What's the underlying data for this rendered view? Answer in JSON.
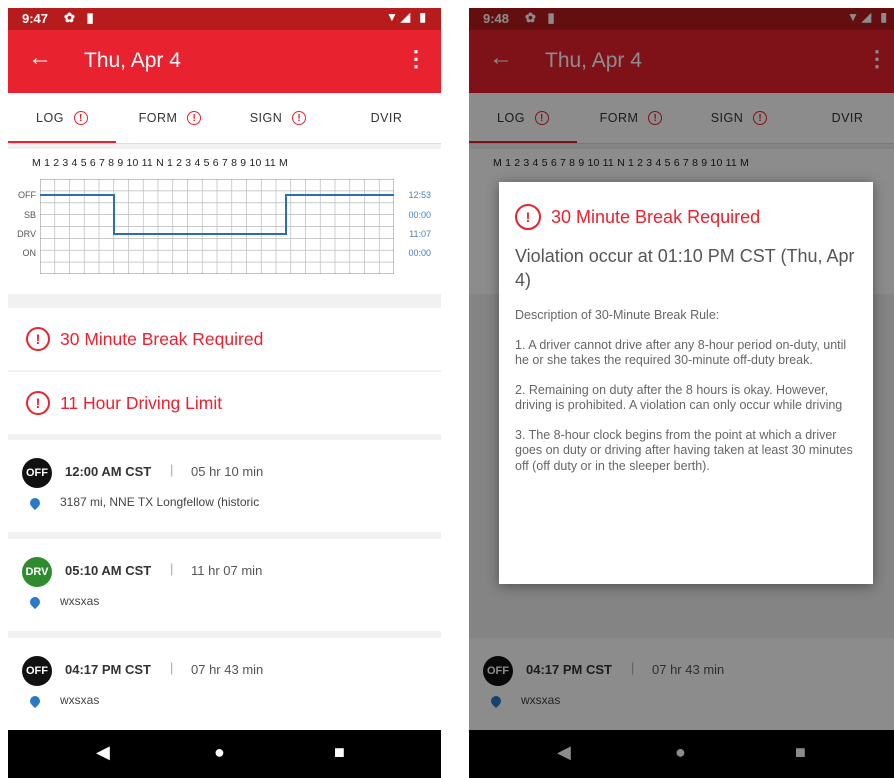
{
  "left": {
    "status": {
      "time": "9:47"
    },
    "appbar": {
      "title": "Thu, Apr 4"
    },
    "tabs": [
      {
        "label": "LOG"
      },
      {
        "label": "FORM"
      },
      {
        "label": "SIGN"
      },
      {
        "label": "DVIR"
      }
    ],
    "graph": {
      "hour_labels": "M 1 2 3 4 5 6 7 8 9 10 11 N 1 2 3 4 5 6 7 8 9 10 11 M",
      "rows": [
        {
          "status": "OFF",
          "total": "12:53"
        },
        {
          "status": "SB",
          "total": "00:00"
        },
        {
          "status": "DRV",
          "total": "11:07"
        },
        {
          "status": "ON",
          "total": "00:00"
        }
      ]
    },
    "violations": [
      {
        "label": "30 Minute Break Required"
      },
      {
        "label": "11 Hour Driving Limit"
      }
    ],
    "entries": [
      {
        "badge": "OFF",
        "time": "12:00 AM CST",
        "duration": "05 hr 10 min",
        "location": "3187 mi, NNE TX Longfellow (historic"
      },
      {
        "badge": "DRV",
        "time": "05:10 AM CST",
        "duration": "11 hr 07 min",
        "location": "wxsxas"
      },
      {
        "badge": "OFF",
        "time": "04:17 PM CST",
        "duration": "07 hr 43 min",
        "location": "wxsxas"
      }
    ],
    "separator": "|"
  },
  "right": {
    "status": {
      "time": "9:48"
    },
    "dialog": {
      "title": "30 Minute Break Required",
      "subtitle": "Violation occur at 01:10 PM CST (Thu, Apr 4)",
      "heading": "Description of 30-Minute Break Rule:",
      "p1": "1. A driver cannot drive after any 8-hour period on-duty, until he or she takes the required 30-minute off-duty break.",
      "p2": "2. Remaining on duty after the 8 hours is okay. However, driving is prohibited. A violation can only occur while driving",
      "p3": "3. The 8-hour clock begins from the point at which a driver goes on duty or driving after having taken at least 30 minutes off (off duty or in the sleeper berth)."
    }
  },
  "colors": {
    "accent": "#e8222e",
    "statusbar": "#b71c1c",
    "off_badge": "#111111",
    "drv_badge": "#2e8b2e",
    "line": "#2a6fb5"
  },
  "icons": {
    "back": "arrow-left-icon",
    "more": "more-vert-icon",
    "alert": "alert-circle-icon",
    "pin": "location-pin-icon"
  }
}
